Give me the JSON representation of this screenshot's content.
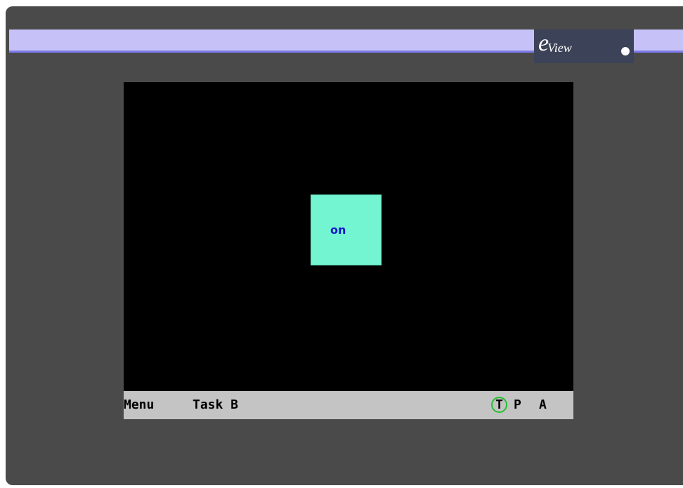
{
  "header": {
    "logo_e": "e",
    "logo_text": "View"
  },
  "screen": {
    "button": {
      "label": "on",
      "color": "#73f5d1"
    }
  },
  "taskbar": {
    "menu": "Menu",
    "task": "Task B",
    "t": "T",
    "p": "P",
    "a": "A"
  }
}
